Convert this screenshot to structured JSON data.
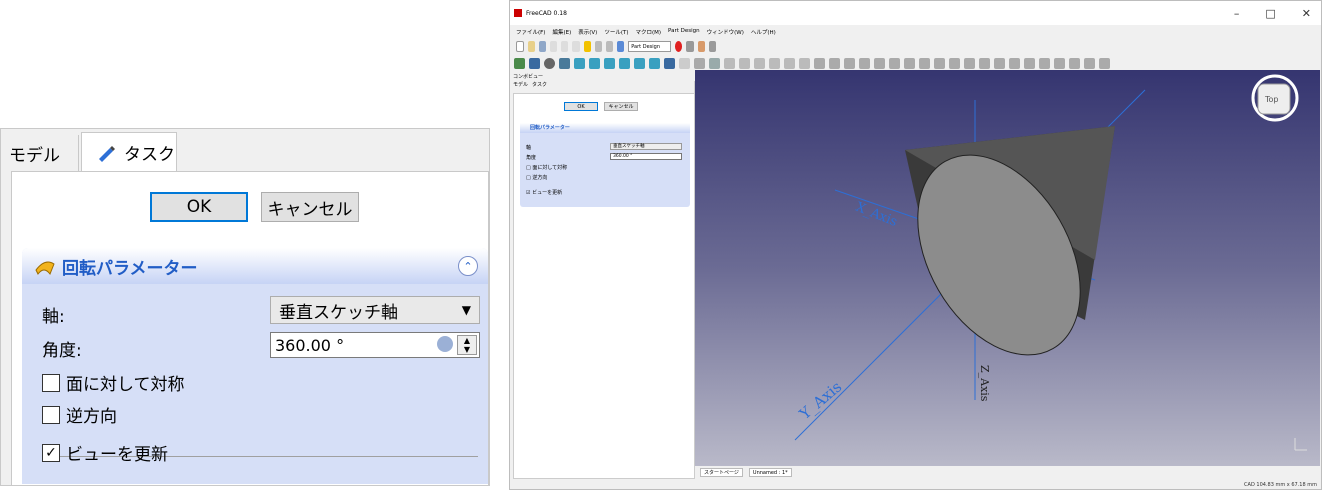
{
  "zoom": {
    "tabs": {
      "model": "モデル",
      "task": "タスク"
    },
    "buttons": {
      "ok": "OK",
      "cancel": "キャンセル"
    },
    "panel": {
      "title": "回転パラメーター",
      "axis_label": "軸:",
      "axis_value": "垂直スケッチ軸",
      "angle_label": "角度:",
      "angle_value": "360.00 °",
      "symmetric_label": "面に対して対称",
      "reversed_label": "逆方向",
      "update_view_label": "ビューを更新",
      "symmetric_checked": false,
      "reversed_checked": false,
      "update_view_checked": true
    }
  },
  "window": {
    "title": "FreeCAD 0.18",
    "controls": [
      "–",
      "□",
      "✕"
    ],
    "menu": [
      "ファイル(F)",
      "編集(E)",
      "表示(V)",
      "ツール(T)",
      "マクロ(M)",
      "Part Design",
      "ウィンドウ(W)",
      "ヘルプ(H)"
    ],
    "workbench": "Part Design",
    "combo_view_title": "コンボビュー",
    "side_tabs": {
      "model": "モデル",
      "task": "タスク"
    },
    "side_buttons": {
      "ok": "OK",
      "cancel": "キャンセル"
    },
    "side_panel": {
      "title": "回転パラメーター",
      "axis_label": "軸",
      "axis_value": "垂直スケッチ軸",
      "angle_label": "角度",
      "angle_value": "360.00 °",
      "symmetric_label": "面に対して対称",
      "reversed_label": "逆方向",
      "update_view_label": "ビューを更新"
    },
    "viewport": {
      "x_axis": "X_Axis",
      "y_axis": "Y_Axis",
      "z_axis": "Z_Axis",
      "navcube_face": "Top"
    },
    "bottom_tabs": [
      "スタートページ",
      "Unnamed : 1*"
    ],
    "status": {
      "mode": "CAD",
      "dims": "104.83 mm x 67.18 mm"
    },
    "colors": {
      "axis_blue": "#2d6fd6",
      "accent_red": "#e02020",
      "panel_title": "#215dc6"
    }
  }
}
